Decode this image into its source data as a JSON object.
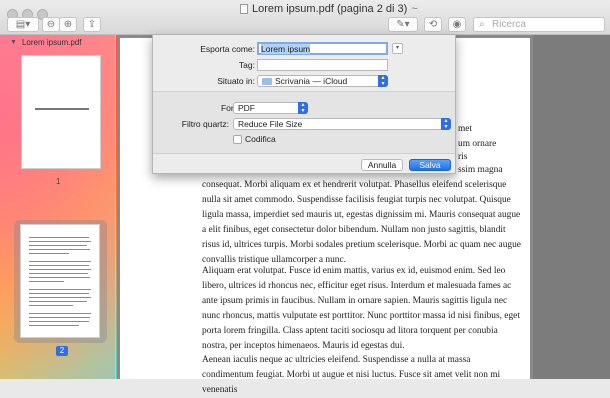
{
  "window": {
    "title": "Lorem ipsum.pdf (pagina 2 di 3)",
    "title_suffix": "~",
    "search_placeholder": "Ricerca"
  },
  "toolbar": {
    "sidebar_button_icon": "sidebar-icon",
    "zoom_out_icon": "zoom-out-icon",
    "zoom_in_icon": "zoom-in-icon",
    "share_icon": "share-icon",
    "markup_icon": "pen-icon",
    "rotate_icon": "rotate-icon",
    "annotate_icon": "annotate-icon"
  },
  "sidebar": {
    "file_name": "Lorem ipsum.pdf",
    "pages": [
      {
        "number": "1"
      },
      {
        "number": "2",
        "selected": true
      }
    ]
  },
  "export_sheet": {
    "export_as_label": "Esporta come:",
    "export_as_value": "Lorem ipsum",
    "tags_label": "Tag:",
    "tags_value": "",
    "location_label": "Situato in:",
    "location_value": "Scrivania — iCloud",
    "format_label": "Formato:",
    "format_value": "PDF",
    "quartz_filter_label": "Filtro quartz:",
    "quartz_filter_value": "Reduce File Size",
    "encrypt_label": "Codifica",
    "encrypt_checked": false,
    "cancel_label": "Annulla",
    "save_label": "Salva"
  },
  "document": {
    "partial_lines": [
      "met",
      "um ornare",
      "ris",
      "ssim magna"
    ],
    "para1": "consequat. Morbi aliquam ex et hendrerit volutpat. Phasellus eleifend scelerisque nulla sit amet commodo. Suspendisse facilisis feugiat turpis nec volutpat. Quisque ligula massa, imperdiet sed mauris ut, egestas dignissim mi. Mauris consequat augue a elit finibus, eget consectetur dolor bibendum. Nullam non justo sagittis, blandit risus id, ultrices turpis. Morbi sodales pretium scelerisque. Morbi ac quam nec augue convallis tristique ullamcorper a nunc.",
    "para2": "Aliquam erat volutpat. Fusce id enim mattis, varius ex id, euismod enim. Sed leo libero, ultrices id rhoncus nec, efficitur eget risus. Interdum et malesuada fames ac ante ipsum primis in faucibus. Nullam in ornare sapien. Mauris sagittis ligula nec nunc rhoncus, mattis vulputate est porttitor. Nunc porttitor massa id nisi finibus, eget porta lorem fringilla. Class aptent taciti sociosqu ad litora torquent per conubia nostra, per inceptos himenaeos. Mauris id egestas dui.",
    "para3": "Aenean iaculis neque ac ultricies eleifend. Suspendisse a nulla at massa condimentum feugiat. Morbi ut augue et nisi luctus. Fusce sit amet velit non mi venenatis"
  },
  "colors": {
    "accent": "#2f6fde",
    "selection": "#b3d0f5"
  }
}
